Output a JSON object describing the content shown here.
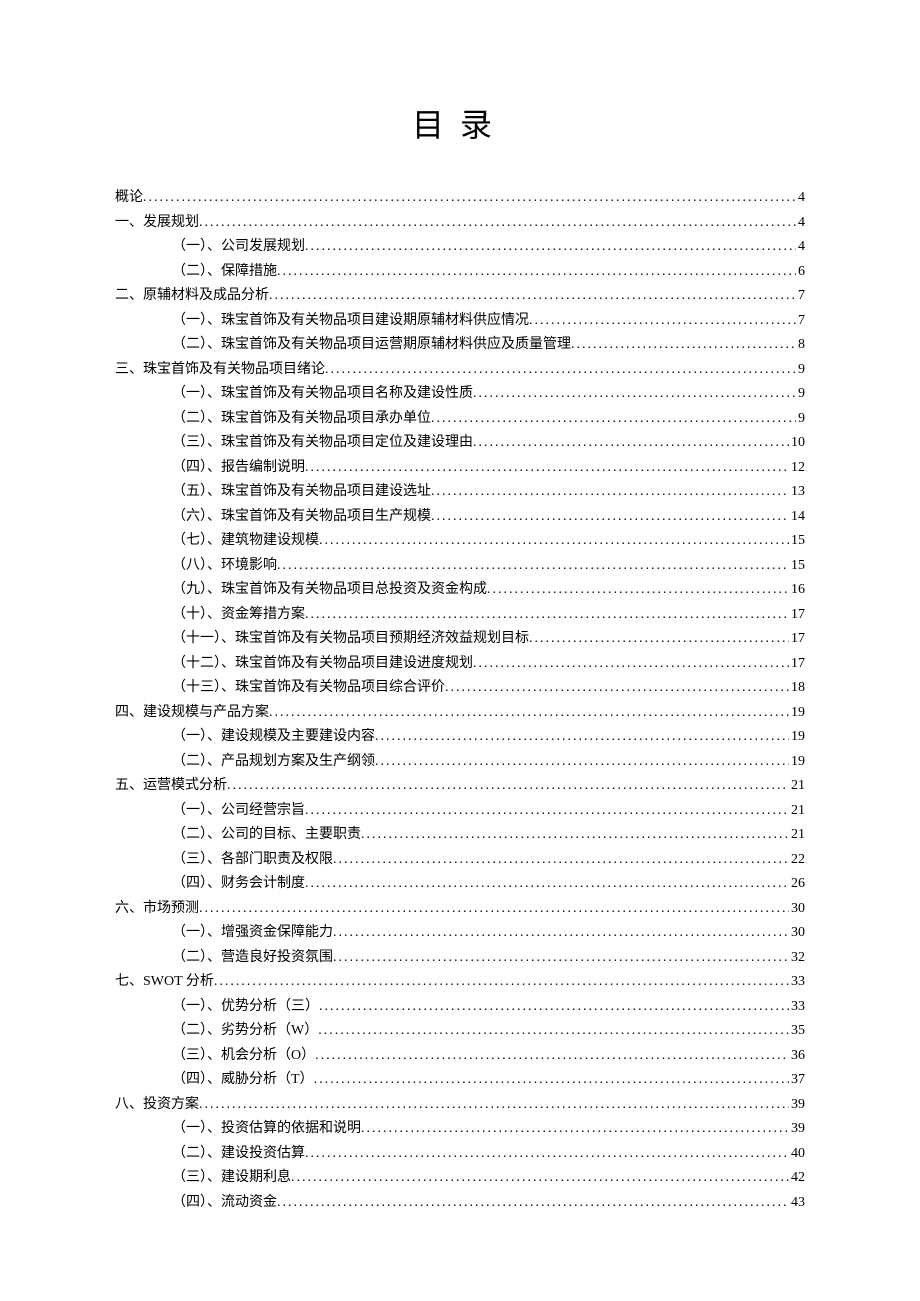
{
  "title": "目录",
  "toc": [
    {
      "level": 0,
      "label": "概论",
      "page": "4"
    },
    {
      "level": 0,
      "label": "一、发展规划",
      "page": "4"
    },
    {
      "level": 1,
      "label": "（一）、公司发展规划",
      "page": "4"
    },
    {
      "level": 1,
      "label": "（二）、保障措施",
      "page": "6"
    },
    {
      "level": 0,
      "label": "二、原辅材料及成品分析",
      "page": "7"
    },
    {
      "level": 1,
      "label": "（一）、珠宝首饰及有关物品项目建设期原辅材料供应情况",
      "page": "7"
    },
    {
      "level": 1,
      "label": "（二）、珠宝首饰及有关物品项目运营期原辅材料供应及质量管理",
      "page": "8"
    },
    {
      "level": 0,
      "label": "三、珠宝首饰及有关物品项目绪论",
      "page": "9"
    },
    {
      "level": 1,
      "label": "（一）、珠宝首饰及有关物品项目名称及建设性质",
      "page": "9"
    },
    {
      "level": 1,
      "label": "（二）、珠宝首饰及有关物品项目承办单位",
      "page": "9"
    },
    {
      "level": 1,
      "label": "（三）、珠宝首饰及有关物品项目定位及建设理由",
      "page": "10"
    },
    {
      "level": 1,
      "label": "（四）、报告编制说明",
      "page": "12"
    },
    {
      "level": 1,
      "label": "（五）、珠宝首饰及有关物品项目建设选址",
      "page": "13"
    },
    {
      "level": 1,
      "label": "（六）、珠宝首饰及有关物品项目生产规模",
      "page": "14"
    },
    {
      "level": 1,
      "label": "（七）、建筑物建设规模",
      "page": "15"
    },
    {
      "level": 1,
      "label": "（八）、环境影响",
      "page": "15"
    },
    {
      "level": 1,
      "label": "（九）、珠宝首饰及有关物品项目总投资及资金构成",
      "page": "16"
    },
    {
      "level": 1,
      "label": "（十）、资金筹措方案",
      "page": "17"
    },
    {
      "level": 1,
      "label": "（十一）、珠宝首饰及有关物品项目预期经济效益规划目标",
      "page": "17"
    },
    {
      "level": 1,
      "label": "（十二）、珠宝首饰及有关物品项目建设进度规划",
      "page": "17"
    },
    {
      "level": 1,
      "label": "（十三）、珠宝首饰及有关物品项目综合评价",
      "page": "18"
    },
    {
      "level": 0,
      "label": "四、建设规模与产品方案",
      "page": "19"
    },
    {
      "level": 1,
      "label": "（一）、建设规模及主要建设内容",
      "page": "19"
    },
    {
      "level": 1,
      "label": "（二）、产品规划方案及生产纲领",
      "page": "19"
    },
    {
      "level": 0,
      "label": "五、运营模式分析",
      "page": "21"
    },
    {
      "level": 1,
      "label": "（一）、公司经营宗旨",
      "page": "21"
    },
    {
      "level": 1,
      "label": "（二）、公司的目标、主要职责",
      "page": "21"
    },
    {
      "level": 1,
      "label": "（三）、各部门职责及权限",
      "page": "22"
    },
    {
      "level": 1,
      "label": "（四）、财务会计制度",
      "page": "26"
    },
    {
      "level": 0,
      "label": "六、市场预测",
      "page": "30"
    },
    {
      "level": 1,
      "label": "（一）、增强资金保障能力",
      "page": "30"
    },
    {
      "level": 1,
      "label": "（二）、营造良好投资氛围",
      "page": "32"
    },
    {
      "level": 0,
      "label": "七、SWOT 分析",
      "page": "33"
    },
    {
      "level": 1,
      "label": "（一）、优势分析（三）",
      "page": "33"
    },
    {
      "level": 1,
      "label": "（二）、劣势分析（W）",
      "page": "35"
    },
    {
      "level": 1,
      "label": "（三）、机会分析（O）",
      "page": "36"
    },
    {
      "level": 1,
      "label": "（四）、威胁分析（T）",
      "page": "37"
    },
    {
      "level": 0,
      "label": "八、投资方案",
      "page": "39"
    },
    {
      "level": 1,
      "label": "（一）、投资估算的依据和说明",
      "page": "39"
    },
    {
      "level": 1,
      "label": "（二）、建设投资估算",
      "page": "40"
    },
    {
      "level": 1,
      "label": "（三）、建设期利息",
      "page": "42"
    },
    {
      "level": 1,
      "label": "（四）、流动资金",
      "page": "43"
    }
  ]
}
